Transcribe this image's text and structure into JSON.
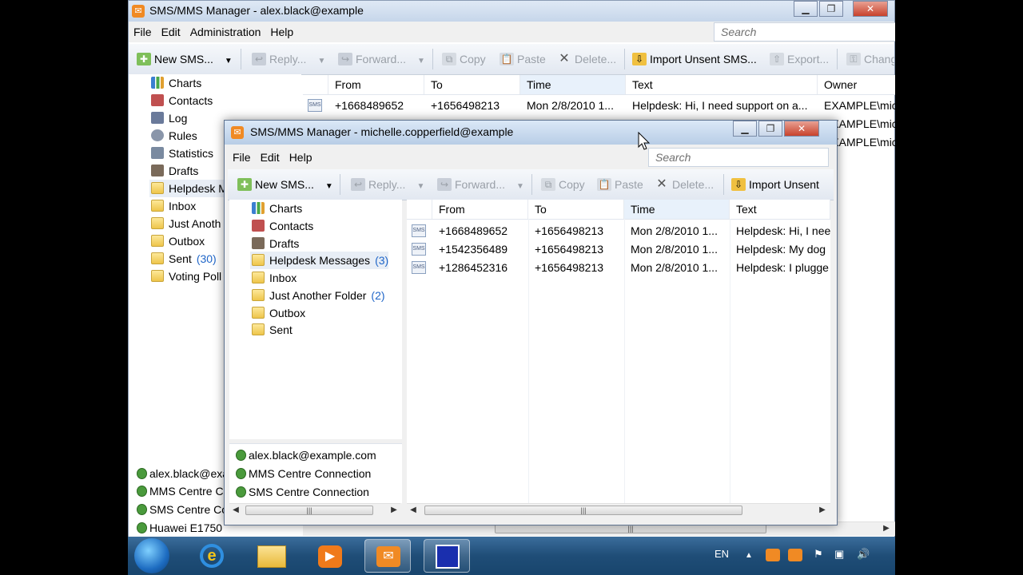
{
  "back_window": {
    "title": "SMS/MMS Manager - alex.black@example",
    "menu": [
      "File",
      "Edit",
      "Administration",
      "Help"
    ],
    "search_placeholder": "Search",
    "toolbar": {
      "new_sms": "New SMS...",
      "reply": "Reply...",
      "forward": "Forward...",
      "copy": "Copy",
      "paste": "Paste",
      "delete": "Delete...",
      "import_unsent": "Import Unsent SMS...",
      "export": "Export...",
      "change": "Chang"
    },
    "tree": [
      {
        "label": "Charts"
      },
      {
        "label": "Contacts"
      },
      {
        "label": "Log"
      },
      {
        "label": "Rules"
      },
      {
        "label": "Statistics"
      },
      {
        "label": "Drafts"
      },
      {
        "label": "Helpdesk M"
      },
      {
        "label": "Inbox"
      },
      {
        "label": "Just Anoth"
      },
      {
        "label": "Outbox"
      },
      {
        "label": "Sent",
        "count": "(30)"
      },
      {
        "label": "Voting Poll"
      }
    ],
    "columns": [
      "From",
      "To",
      "Time",
      "Text",
      "Owner"
    ],
    "rows": [
      {
        "from": "+1668489652",
        "to": "+1656498213",
        "time": "Mon 2/8/2010 1...",
        "text": "Helpdesk: Hi, I need support on a...",
        "owner": "EXAMPLE\\mic"
      }
    ],
    "owner_partial": [
      "EXAMPLE\\mic",
      "EXAMPLE\\mic"
    ],
    "connections": [
      "alex.black@exa",
      "MMS Centre C",
      "SMS Centre Co",
      "Huawei E1750"
    ]
  },
  "front_window": {
    "title": "SMS/MMS Manager - michelle.copperfield@example",
    "menu": [
      "File",
      "Edit",
      "Help"
    ],
    "search_placeholder": "Search",
    "toolbar": {
      "new_sms": "New SMS...",
      "reply": "Reply...",
      "forward": "Forward...",
      "copy": "Copy",
      "paste": "Paste",
      "delete": "Delete...",
      "import_unsent": "Import Unsent"
    },
    "tree": [
      {
        "label": "Charts"
      },
      {
        "label": "Contacts"
      },
      {
        "label": "Drafts"
      },
      {
        "label": "Helpdesk Messages",
        "count": "(3)"
      },
      {
        "label": "Inbox"
      },
      {
        "label": "Just Another Folder",
        "count": "(2)"
      },
      {
        "label": "Outbox"
      },
      {
        "label": "Sent"
      }
    ],
    "columns": [
      "From",
      "To",
      "Time",
      "Text"
    ],
    "rows": [
      {
        "from": "+1668489652",
        "to": "+1656498213",
        "time": "Mon 2/8/2010 1...",
        "text": "Helpdesk: Hi, I nee"
      },
      {
        "from": "+1542356489",
        "to": "+1656498213",
        "time": "Mon 2/8/2010 1...",
        "text": "Helpdesk: My dog"
      },
      {
        "from": "+1286452316",
        "to": "+1656498213",
        "time": "Mon 2/8/2010 1...",
        "text": "Helpdesk: I plugge"
      }
    ],
    "connections": [
      "alex.black@example.com",
      "MMS Centre Connection",
      "SMS Centre Connection"
    ]
  },
  "taskbar": {
    "language": "EN"
  },
  "colors": {
    "accent": "#2066c8",
    "titlebar": "#c6d6ea",
    "taskbar": "#1f4d77"
  }
}
